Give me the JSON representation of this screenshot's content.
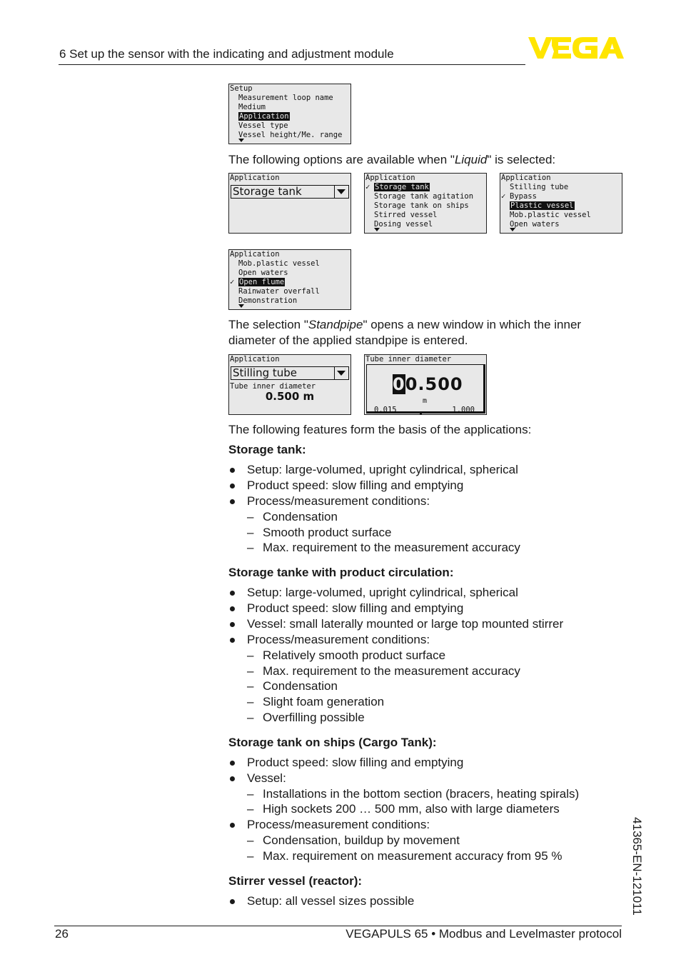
{
  "header": {
    "section_title": "6 Set up the sensor with the indicating and adjustment module",
    "logo_text": "VEGA",
    "logo_color": "#FFE500"
  },
  "displays": {
    "setup_menu": {
      "title": "Setup",
      "items": [
        "Measurement loop name",
        "Medium",
        "Application",
        "Vessel type",
        "Vessel height/Me. range"
      ],
      "selected_index": 2
    },
    "app_combo": {
      "title": "Application",
      "value": "Storage tank"
    },
    "app_list_1": {
      "title": "Application",
      "items": [
        "Storage tank",
        "Storage tank agitation",
        "Storage tank on ships",
        "Stirred vessel",
        "Dosing vessel"
      ],
      "checked_index": 0,
      "selected_index": 0
    },
    "app_list_2": {
      "title": "Application",
      "items": [
        "Stilling tube",
        "Bypass",
        "Plastic vessel",
        "Mob.plastic vessel",
        "Open waters"
      ],
      "checked_index": 1,
      "selected_index": 2
    },
    "app_list_3": {
      "title": "Application",
      "items": [
        "Mob.plastic vessel",
        "Open waters",
        "Open flume",
        "Rainwater overfall",
        "Demonstration"
      ],
      "checked_index": 2,
      "selected_index": 2
    },
    "stilling_combo": {
      "title": "Application",
      "value": "Stilling tube",
      "sub_label": "Tube inner diameter",
      "sub_value": "0.500 m"
    },
    "tube_edit": {
      "title": "Tube inner diameter",
      "cursor_digit": "0",
      "value_rest": "0.500",
      "unit": "m",
      "min": "0.015",
      "max": "1.000",
      "slider_position_fraction": 0.49
    },
    "checkmark": "✓"
  },
  "text": {
    "liquid_intro_pre": "The following options are available when \"",
    "liquid_intro_em": "Liquid",
    "liquid_intro_post": "\" is selected:",
    "standpipe_pre": "The selection \"",
    "standpipe_em": "Standpipe",
    "standpipe_post": "\" opens a new window in which the inner diameter of the applied standpipe is entered.",
    "features_intro": "The following features form the basis of the applications:"
  },
  "sections": [
    {
      "heading": "Storage tank:",
      "bullets": [
        "Setup: large-volumed, upright cylindrical, spherical",
        "Product speed: slow filling and emptying",
        "Process/measurement conditions:"
      ],
      "dashes": [
        "Condensation",
        "Smooth product surface",
        "Max. requirement to the measurement accuracy"
      ]
    },
    {
      "heading": "Storage tanke with product circulation:",
      "bullets": [
        "Setup: large-volumed, upright cylindrical, spherical",
        "Product speed: slow filling and emptying",
        "Vessel: small laterally mounted or large top mounted stirrer",
        "Process/measurement conditions:"
      ],
      "dashes": [
        "Relatively smooth product surface",
        "Max. requirement to the measurement accuracy",
        "Condensation",
        "Slight foam generation",
        "Overfilling possible"
      ]
    },
    {
      "heading": "Storage tank on ships (Cargo Tank):",
      "bullets": [
        "Product speed: slow filling and emptying",
        "Vessel:",
        "Process/measurement conditions:"
      ],
      "vessel_dashes": [
        "Installations in the bottom section (bracers, heating spirals)",
        "High sockets 200 … 500 mm, also with large diameters"
      ],
      "dashes": [
        "Condensation, buildup by movement",
        "Max. requirement on measurement accuracy from 95 %"
      ]
    },
    {
      "heading": "Stirrer vessel (reactor):",
      "bullets": [
        "Setup: all vessel sizes possible"
      ]
    }
  ],
  "footer": {
    "page_number": "26",
    "product": "VEGAPULS 65 • Modbus and Levelmaster protocol",
    "doc_id": "41365-EN-121011"
  },
  "bullet_glyph": "●",
  "dash_glyph": "–"
}
